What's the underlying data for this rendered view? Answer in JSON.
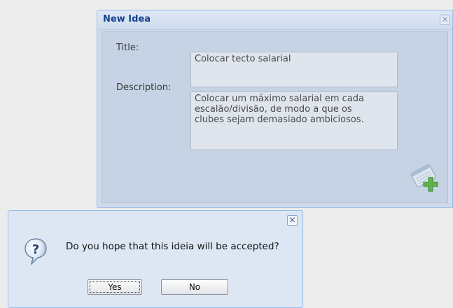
{
  "idea_window": {
    "title": "New Idea",
    "close_glyph": "✕",
    "form": {
      "title_label": "Title:",
      "title_value": "Colocar tecto salarial",
      "description_label": "Description:",
      "description_value": "Colocar um máximo salarial em cada\nescalão/divisão, de modo a que os\nclubes sejam demasiado ambiciosos."
    },
    "add_icon": "notepad-add-icon"
  },
  "confirm_dialog": {
    "close_glyph": "✕",
    "icon": "question-icon",
    "message": "Do you hope that this ideia will be accepted?",
    "buttons": {
      "yes_label": "Yes",
      "no_label": "No"
    }
  },
  "colors": {
    "window_bg": "#cfdaea",
    "window_border": "#99bbe8",
    "title_text": "#15428b",
    "dialog_bg": "#dde7f4"
  }
}
